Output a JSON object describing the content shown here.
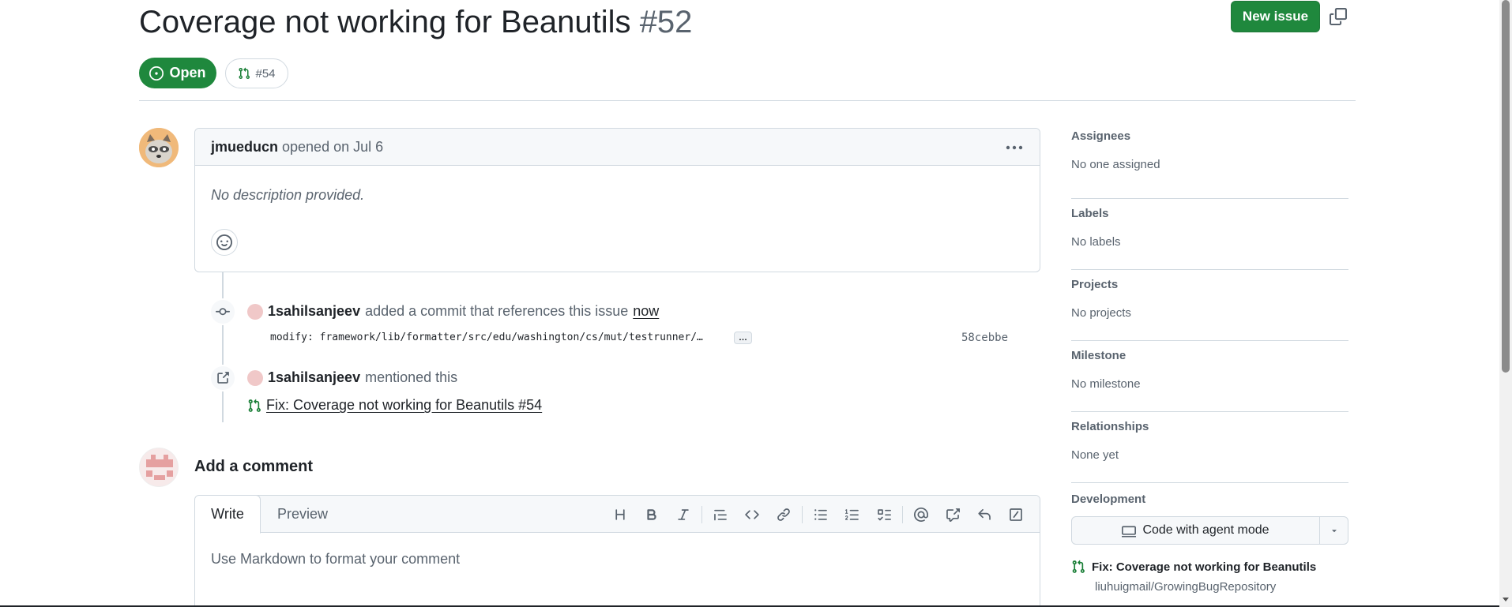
{
  "header": {
    "title": "Coverage not working for Beanutils",
    "issue_number": "#52",
    "new_issue_label": "New issue",
    "state_label": "Open",
    "linked_pr_label": "#54"
  },
  "comment": {
    "author": "jmueducn",
    "meta": "opened on Jul 6",
    "body": "No description provided."
  },
  "timeline": {
    "commit_event": {
      "actor": "1sahilsanjeev",
      "action": "added a commit that references this issue",
      "time": "now",
      "message": "modify: framework/lib/formatter/src/edu/washington/cs/mut/testrunner/…",
      "ellipsis": "…",
      "sha": "58cebbe"
    },
    "mention_event": {
      "actor": "1sahilsanjeev",
      "action": "mentioned this",
      "pr_title": "Fix: Coverage not working for Beanutils #54"
    }
  },
  "add_comment": {
    "title": "Add a comment",
    "tab_write": "Write",
    "tab_preview": "Preview",
    "placeholder": "Use Markdown to format your comment",
    "toolbar": [
      "heading-icon",
      "bold-icon",
      "italic-icon",
      "quote-icon",
      "code-icon",
      "link-icon",
      "unordered-list-icon",
      "ordered-list-icon",
      "task-list-icon",
      "mention-icon",
      "cross-reference-icon",
      "reply-icon",
      "slash-command-icon"
    ]
  },
  "sidebar": {
    "sections": [
      {
        "heading": "Assignees",
        "value": "No one assigned"
      },
      {
        "heading": "Labels",
        "value": "No labels"
      },
      {
        "heading": "Projects",
        "value": "No projects"
      },
      {
        "heading": "Milestone",
        "value": "No milestone"
      },
      {
        "heading": "Relationships",
        "value": "None yet"
      }
    ],
    "development": {
      "heading": "Development",
      "agent_button": "Code with agent mode",
      "pr_title": "Fix: Coverage not working for Beanutils",
      "repo": "liuhuigmail/GrowingBugRepository"
    }
  },
  "colors": {
    "open_green": "#1f883d",
    "muted_text": "#59636e",
    "border": "#d1d9e0"
  }
}
